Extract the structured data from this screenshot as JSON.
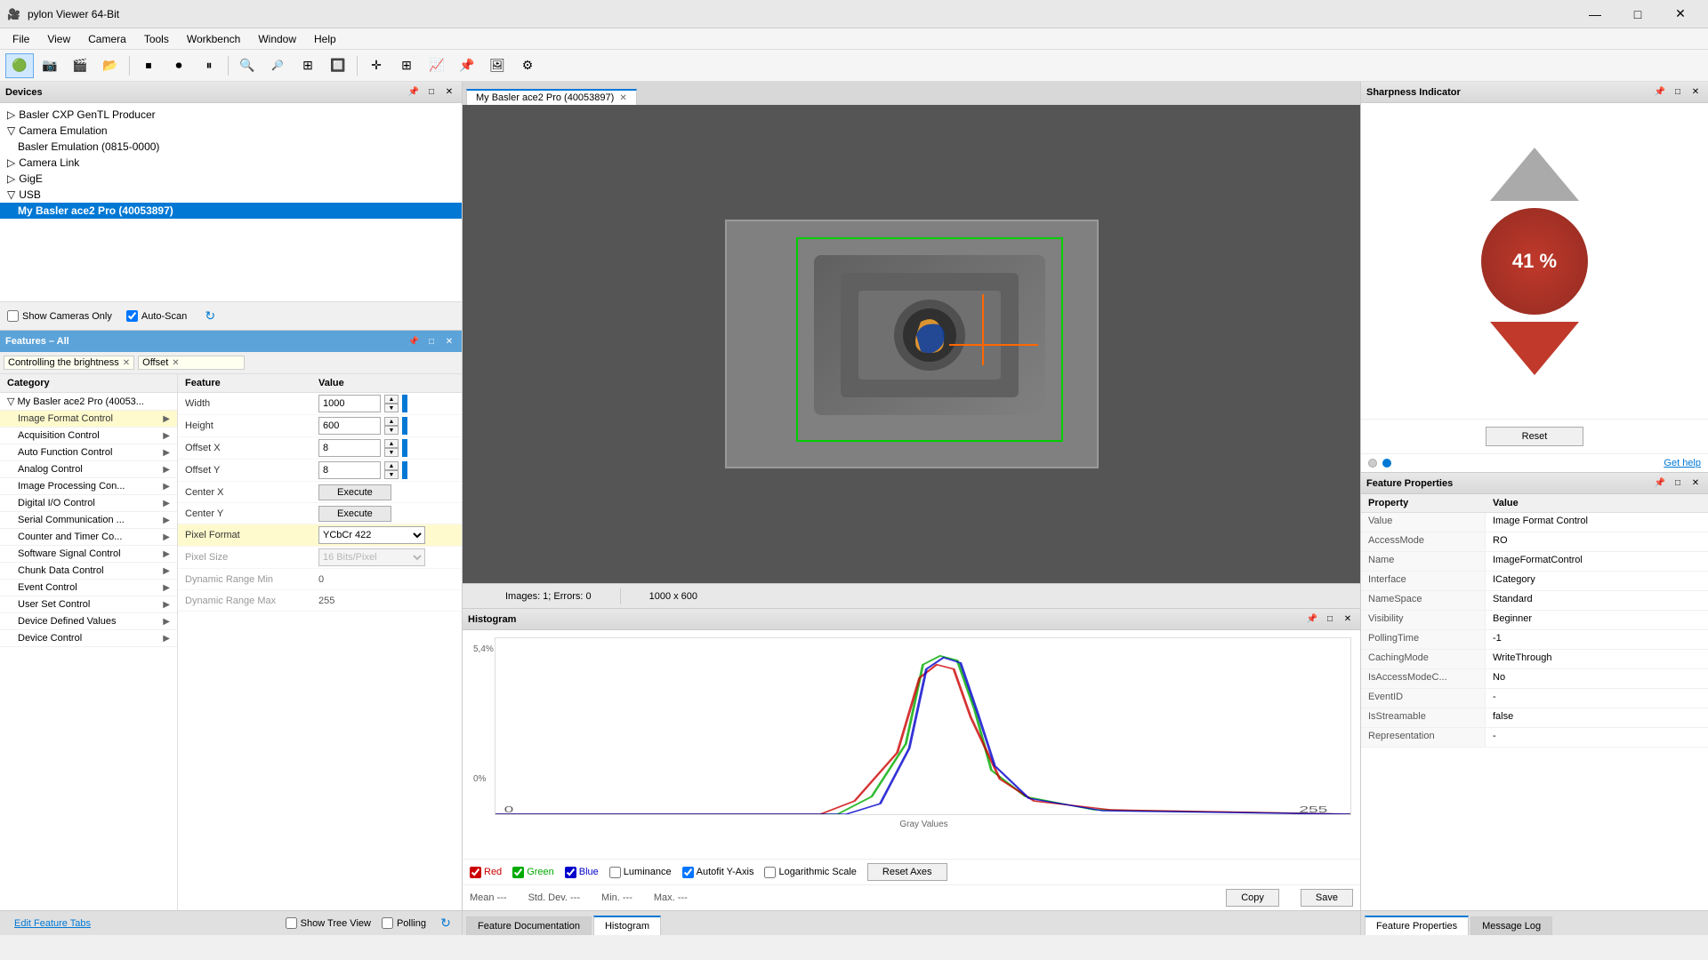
{
  "app": {
    "title": "pylon Viewer 64-Bit",
    "icon": "🎥"
  },
  "titlebar": {
    "minimize": "—",
    "maximize": "□",
    "close": "✕"
  },
  "menu": {
    "items": [
      "File",
      "View",
      "Camera",
      "Tools",
      "Workbench",
      "Window",
      "Help"
    ]
  },
  "toolbar": {
    "buttons": [
      "🟢",
      "📷",
      "🎬",
      "📁",
      "⏹",
      "⏺",
      "⏸",
      "🔍+",
      "🔍-",
      "🔲",
      "🔍",
      "✚",
      "⊞",
      "📈",
      "📌",
      "🖼",
      "⚙"
    ]
  },
  "devices": {
    "panel_title": "Devices",
    "tree": [
      {
        "label": "Basler CXP GenTL Producer",
        "indent": 0
      },
      {
        "label": "Camera Emulation",
        "indent": 0,
        "expanded": true
      },
      {
        "label": "Basler Emulation (0815-0000)",
        "indent": 1
      },
      {
        "label": "Camera Link",
        "indent": 0
      },
      {
        "label": "GigE",
        "indent": 0
      },
      {
        "label": "USB",
        "indent": 0,
        "expanded": true
      },
      {
        "label": "My Basler ace2 Pro (40053897)",
        "indent": 1,
        "selected": true
      }
    ],
    "show_cameras_only": "Show Cameras Only",
    "auto_scan": "Auto-Scan"
  },
  "features": {
    "panel_title": "Features – All",
    "search1": "Controlling the brightness",
    "search2": "Offset",
    "categories": [
      {
        "label": "My Basler ace2 Pro (40053...",
        "indent": 0,
        "expanded": true
      },
      {
        "label": "Image Format Control",
        "indent": 1,
        "highlighted": true
      },
      {
        "label": "Acquisition Control",
        "indent": 1
      },
      {
        "label": "Auto Function Control",
        "indent": 1
      },
      {
        "label": "Analog Control",
        "indent": 1
      },
      {
        "label": "Image Processing Con...",
        "indent": 1
      },
      {
        "label": "Digital I/O Control",
        "indent": 1
      },
      {
        "label": "Serial Communication ...",
        "indent": 1
      },
      {
        "label": "Counter and Timer Co...",
        "indent": 1
      },
      {
        "label": "Software Signal Control",
        "indent": 1
      },
      {
        "label": "Chunk Data Control",
        "indent": 1
      },
      {
        "label": "Event Control",
        "indent": 1
      },
      {
        "label": "User Set Control",
        "indent": 1
      },
      {
        "label": "Device Defined Values",
        "indent": 1
      },
      {
        "label": "Device Control",
        "indent": 1
      }
    ],
    "col_category": "Category",
    "col_feature": "Feature",
    "col_value": "Value",
    "features_list": [
      {
        "name": "Width",
        "value": "1000",
        "type": "spinner",
        "has_bar": true,
        "disabled": false
      },
      {
        "name": "Height",
        "value": "600",
        "type": "spinner",
        "has_bar": true,
        "disabled": false
      },
      {
        "name": "Offset X",
        "value": "8",
        "type": "spinner",
        "has_bar": true,
        "disabled": false
      },
      {
        "name": "Offset Y",
        "value": "8",
        "type": "spinner",
        "has_bar": true,
        "disabled": false
      },
      {
        "name": "Center X",
        "value": "Execute",
        "type": "execute",
        "disabled": false
      },
      {
        "name": "Center Y",
        "value": "Execute",
        "type": "execute",
        "disabled": false
      },
      {
        "name": "Pixel Format",
        "value": "YCbCr 422",
        "type": "select",
        "highlighted": true,
        "disabled": false
      },
      {
        "name": "Pixel Size",
        "value": "16 Bits/Pixel",
        "type": "select_disabled",
        "disabled": true
      },
      {
        "name": "Dynamic Range Min",
        "value": "0",
        "type": "static",
        "disabled": true
      },
      {
        "name": "Dynamic Range Max",
        "value": "255",
        "type": "static",
        "disabled": true
      }
    ]
  },
  "status_bar": {
    "edit_feature_tabs": "Edit Feature Tabs",
    "show_tree_view": "Show Tree View",
    "polling": "Polling"
  },
  "image_viewer": {
    "tab_title": "My Basler ace2 Pro (40053897)",
    "images_label": "Images: 1; Errors: 0",
    "resolution": "1000 x 600"
  },
  "histogram": {
    "panel_title": "Histogram",
    "y_max": "5,4%",
    "y_min": "0%",
    "x_min": "0",
    "x_max": "255",
    "x_label": "Gray Values",
    "channels": [
      {
        "name": "Red",
        "checked": true,
        "color": "#cc0000"
      },
      {
        "name": "Green",
        "checked": true,
        "color": "#00aa00"
      },
      {
        "name": "Blue",
        "checked": true,
        "color": "#0000cc"
      },
      {
        "name": "Luminance",
        "checked": false,
        "color": "#888"
      }
    ],
    "autofit": "Autofit Y-Axis",
    "autofit_checked": true,
    "log_scale": "Logarithmic Scale",
    "log_checked": false,
    "reset_axes": "Reset Axes",
    "mean_label": "Mean",
    "mean_value": "---",
    "stddev_label": "Std. Dev.",
    "stddev_value": "---",
    "min_label": "Min.",
    "min_value": "---",
    "max_label": "Max.",
    "max_value": "---",
    "copy_btn": "Copy",
    "save_btn": "Save"
  },
  "bottom_tabs": [
    {
      "label": "Feature Documentation",
      "active": false
    },
    {
      "label": "Histogram",
      "active": true
    }
  ],
  "sharpness": {
    "panel_title": "Sharpness Indicator",
    "value": "41 %",
    "reset_btn": "Reset",
    "help_link": "Get help"
  },
  "feature_props": {
    "panel_title": "Feature Properties",
    "col_property": "Property",
    "col_value": "Value",
    "rows": [
      {
        "property": "Value",
        "value": "Image Format Control"
      },
      {
        "property": "AccessMode",
        "value": "RO"
      },
      {
        "property": "Name",
        "value": "ImageFormatControl"
      },
      {
        "property": "Interface",
        "value": "ICategory"
      },
      {
        "property": "NameSpace",
        "value": "Standard"
      },
      {
        "property": "Visibility",
        "value": "Beginner"
      },
      {
        "property": "PollingTime",
        "value": "-1"
      },
      {
        "property": "CachingMode",
        "value": "WriteThrough"
      },
      {
        "property": "IsAccessModeC...",
        "value": "No"
      },
      {
        "property": "EventID",
        "value": "-"
      },
      {
        "property": "IsStreamable",
        "value": "false"
      },
      {
        "property": "Representation",
        "value": "-"
      }
    ]
  },
  "right_tabs": [
    {
      "label": "Feature Properties",
      "active": true
    },
    {
      "label": "Message Log",
      "active": false
    }
  ]
}
